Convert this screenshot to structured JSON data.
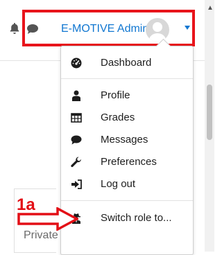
{
  "header": {
    "user_name": "E-MOTIVE Admin"
  },
  "user_menu": {
    "items": [
      {
        "label": "Dashboard",
        "icon": "tachometer-icon"
      },
      {
        "label": "Profile",
        "icon": "user-icon"
      },
      {
        "label": "Grades",
        "icon": "table-icon"
      },
      {
        "label": "Messages",
        "icon": "comment-icon"
      },
      {
        "label": "Preferences",
        "icon": "wrench-icon"
      },
      {
        "label": "Log out",
        "icon": "sign-out-icon"
      },
      {
        "label": "Switch role to...",
        "icon": "user-secret-icon"
      }
    ]
  },
  "background": {
    "private_files": "Private files"
  },
  "annotation": {
    "step_label": "1a"
  },
  "colors": {
    "highlight_red": "#e8141b",
    "link_blue": "#1177d1"
  }
}
